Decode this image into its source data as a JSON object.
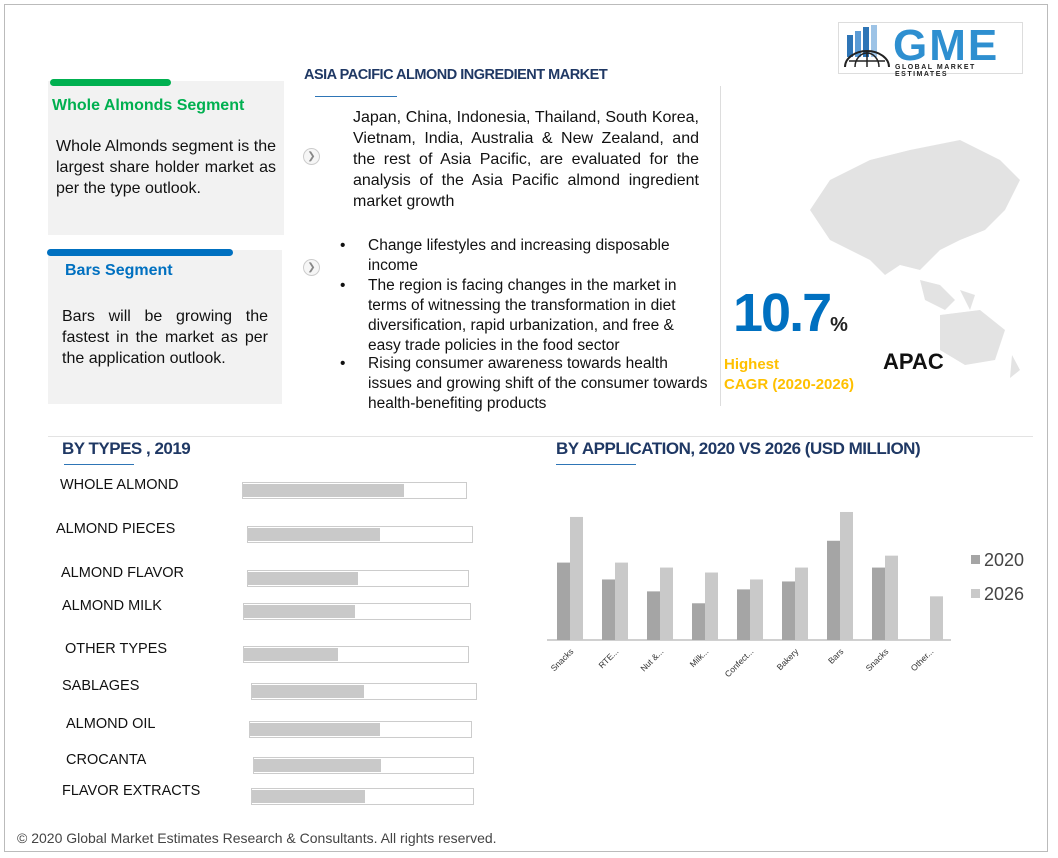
{
  "title": "ASIA PACIFIC ALMOND INGREDIENT MARKET",
  "logo": {
    "text": "GME",
    "subtitle": "GLOBAL MARKET ESTIMATES"
  },
  "segments": [
    {
      "title": "Whole Almonds  Segment",
      "text": "Whole Almonds segment is the largest share holder market as per the type outlook.",
      "color": "#00b050"
    },
    {
      "title": "Bars Segment",
      "text": "Bars will be growing the fastest in the market as per the application outlook.",
      "color": "#0070c0"
    }
  ],
  "intro": "Japan, China, Indonesia, Thailand, South Korea, Vietnam, India, Australia & New Zealand, and the rest of Asia Pacific, are evaluated for the analysis of the Asia Pacific almond ingredient market growth",
  "bullets": [
    "Change lifestyles and increasing disposable income",
    "The region is facing changes in the market in terms of witnessing the transformation in diet diversification, rapid urbanization, and free & easy trade policies in the food sector",
    "Rising consumer awareness towards health issues and growing shift of the consumer towards health-benefiting products"
  ],
  "cagr": {
    "value": "10.7",
    "unit": "%",
    "label1": "Highest",
    "label2": "CAGR (2020-2026)",
    "region": "APAC"
  },
  "types": {
    "heading": "BY TYPES , 2019",
    "items": [
      {
        "label": "WHOLE ALMOND",
        "share": 0.72
      },
      {
        "label": "ALMOND PIECES",
        "share": 0.59
      },
      {
        "label": "ALMOND FLAVOR",
        "share": 0.5
      },
      {
        "label": "ALMOND MILK",
        "share": 0.49
      },
      {
        "label": "OTHER TYPES",
        "share": 0.42
      },
      {
        "label": "SABLAGES",
        "share": 0.5
      },
      {
        "label": "ALMOND OIL",
        "share": 0.59
      },
      {
        "label": "CROCANTA",
        "share": 0.58
      },
      {
        "label": "FLAVOR EXTRACTS",
        "share": 0.51
      }
    ]
  },
  "chart_data": {
    "type": "bar",
    "title": "BY APPLICATION,  2020 VS 2026 (USD MILLION)",
    "categories": [
      "Snacks",
      "RTE...",
      "Nut &...",
      "Milk...",
      "Confect...",
      "Bakery",
      "Bars",
      "Snacks",
      "Other..."
    ],
    "series": [
      {
        "name": "2020",
        "color": "#a5a5a5",
        "values": [
          78,
          61,
          49,
          37,
          51,
          59,
          100,
          73,
          0
        ]
      },
      {
        "name": "2026",
        "color": "#c9c9c9",
        "values": [
          124,
          78,
          73,
          68,
          61,
          73,
          129,
          85,
          44
        ]
      }
    ],
    "ylim": [
      0,
      130
    ],
    "grid": false,
    "legend": "right"
  },
  "footer": "© 2020 Global Market Estimates Research & Consultants. All rights reserved."
}
